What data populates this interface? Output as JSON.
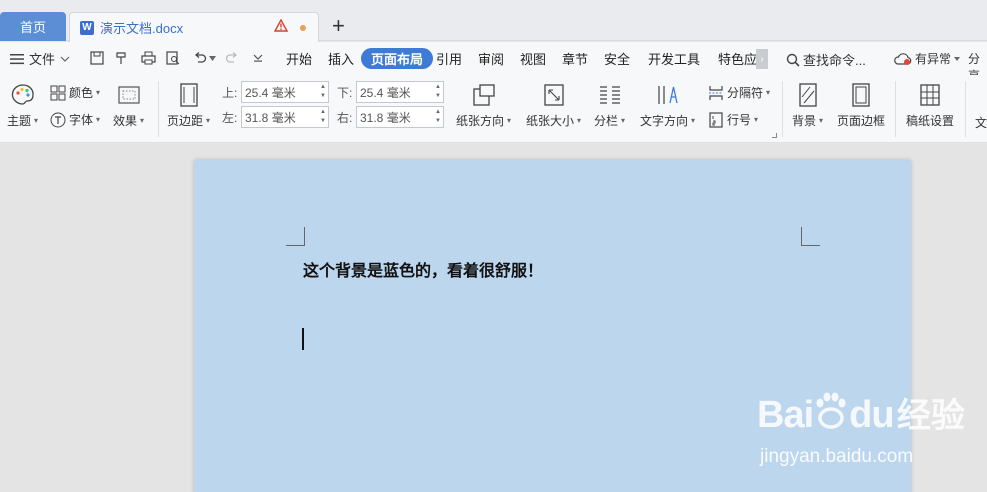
{
  "tabs": {
    "home": "首页",
    "doc_title": "演示文档.docx",
    "add": "+"
  },
  "menubar": {
    "file": "文件",
    "tabs": [
      "开始",
      "插入",
      "页面布局",
      "引用",
      "审阅",
      "视图",
      "章节",
      "安全",
      "开发工具",
      "特色应"
    ],
    "active_tab": "页面布局",
    "search": "查找命令...",
    "status": "有异常",
    "share": "分享"
  },
  "ribbon": {
    "theme": "主题",
    "color": "颜色",
    "font": "字体",
    "effect": "效果",
    "margin": "页边距",
    "top_label": "上:",
    "top_value": "25.4 毫米",
    "bottom_label": "下:",
    "bottom_value": "25.4 毫米",
    "left_label": "左:",
    "left_value": "31.8 毫米",
    "right_label": "右:",
    "right_value": "31.8 毫米",
    "orientation": "纸张方向",
    "size": "纸张大小",
    "columns": "分栏",
    "text_direction": "文字方向",
    "separator": "分隔符",
    "line_number": "行号",
    "background": "背景",
    "page_border": "页面边框",
    "manuscript": "稿纸设置",
    "text_cut": "文"
  },
  "document": {
    "text": "这个背景是蓝色的，看着很舒服！",
    "page_color": "#bcd6ee"
  },
  "watermark": {
    "brand": "Bai",
    "brand2": "du",
    "cn": "经验",
    "url": "jingyan.baidu.com"
  }
}
